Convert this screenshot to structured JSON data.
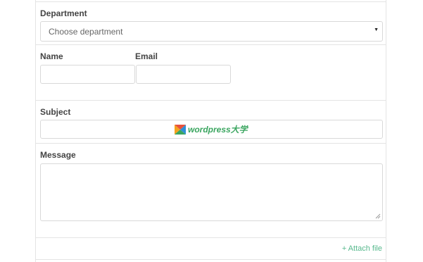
{
  "form": {
    "department": {
      "label": "Department",
      "selected": "Choose department"
    },
    "name": {
      "label": "Name",
      "value": ""
    },
    "email": {
      "label": "Email",
      "value": ""
    },
    "subject": {
      "label": "Subject",
      "value": ""
    },
    "message": {
      "label": "Message",
      "value": ""
    },
    "attach_label": "+ Attach file"
  },
  "watermark": {
    "text": "wordpress大学"
  },
  "colors": {
    "accent": "#57b98d",
    "border": "#d9d9d9",
    "label": "#444444"
  },
  "icons": [
    "select-caret-icon",
    "resize-handle-icon",
    "wordpress-logo-icon"
  ]
}
